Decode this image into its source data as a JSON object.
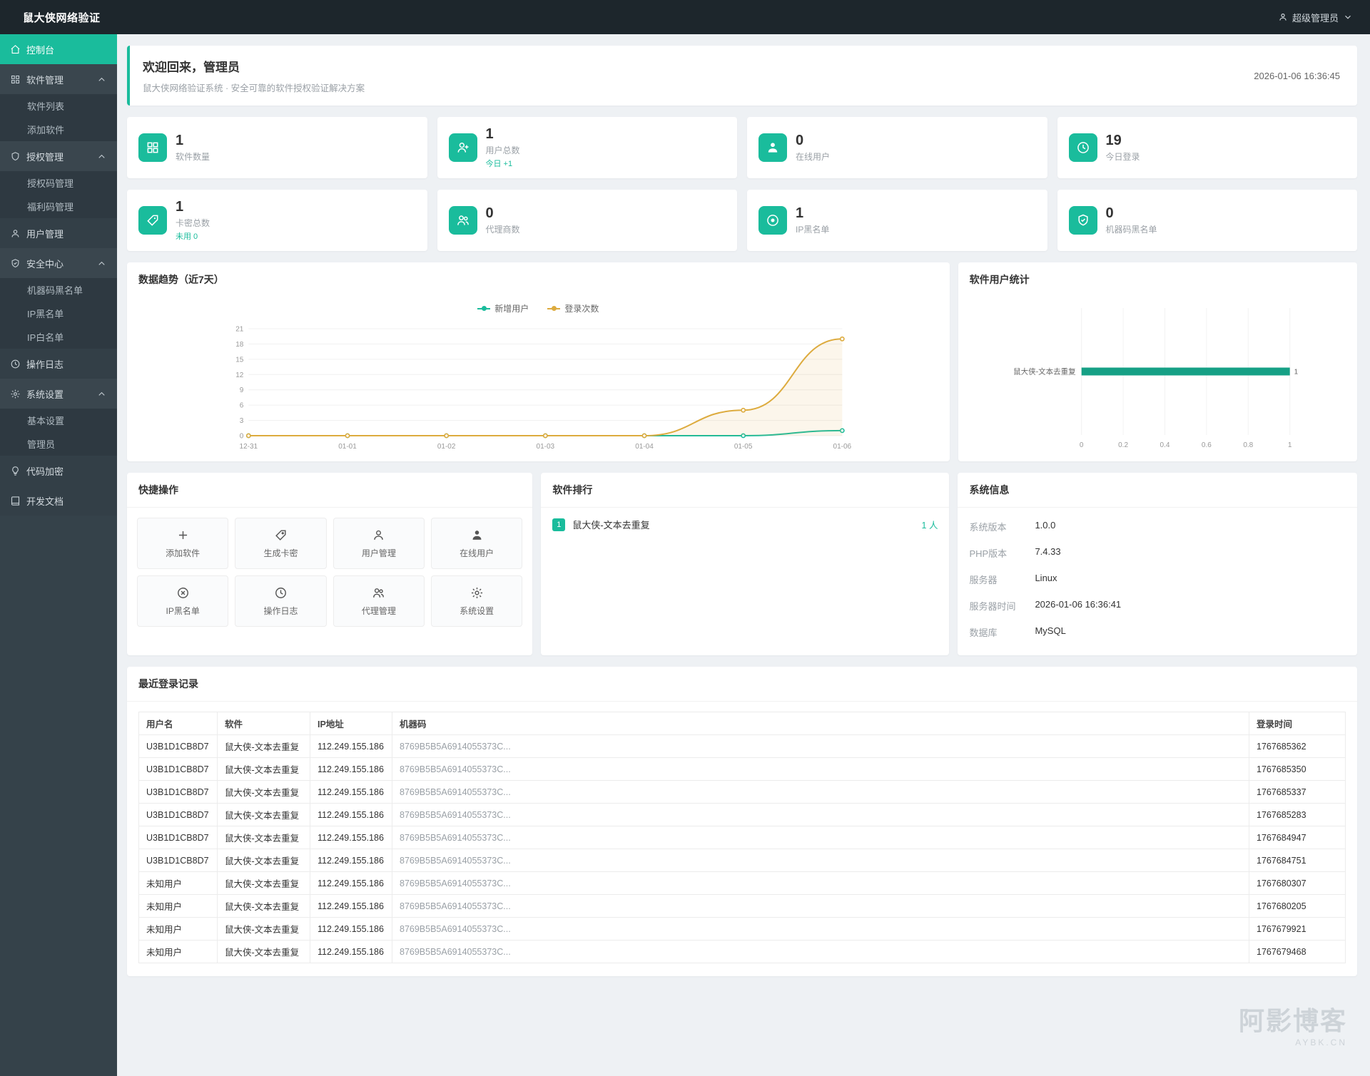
{
  "topbar": {
    "title": "鼠大侠网络验证",
    "user_label": "超级管理员"
  },
  "sidebar": {
    "items": [
      {
        "label": "控制台"
      },
      {
        "label": "软件管理"
      },
      {
        "label": "软件列表"
      },
      {
        "label": "添加软件"
      },
      {
        "label": "授权管理"
      },
      {
        "label": "授权码管理"
      },
      {
        "label": "福利码管理"
      },
      {
        "label": "用户管理"
      },
      {
        "label": "安全中心"
      },
      {
        "label": "机器码黑名单"
      },
      {
        "label": "IP黑名单"
      },
      {
        "label": "IP白名单"
      },
      {
        "label": "操作日志"
      },
      {
        "label": "系统设置"
      },
      {
        "label": "基本设置"
      },
      {
        "label": "管理员"
      },
      {
        "label": "代码加密"
      },
      {
        "label": "开发文档"
      }
    ]
  },
  "welcome": {
    "title": "欢迎回来，管理员",
    "subtitle": "鼠大侠网络验证系统 · 安全可靠的软件授权验证解决方案",
    "time": "2026-01-06 16:36:45"
  },
  "stats": [
    {
      "value": "1",
      "label": "软件数量",
      "extra": ""
    },
    {
      "value": "1",
      "label": "用户总数",
      "extra": "今日 +1"
    },
    {
      "value": "0",
      "label": "在线用户",
      "extra": ""
    },
    {
      "value": "19",
      "label": "今日登录",
      "extra": ""
    },
    {
      "value": "1",
      "label": "卡密总数",
      "extra": "未用 0"
    },
    {
      "value": "0",
      "label": "代理商数",
      "extra": ""
    },
    {
      "value": "1",
      "label": "IP黑名单",
      "extra": ""
    },
    {
      "value": "0",
      "label": "机器码黑名单",
      "extra": ""
    }
  ],
  "chart_data": [
    {
      "type": "line",
      "title": "数据趋势（近7天）",
      "x": [
        "12-31",
        "01-01",
        "01-02",
        "01-03",
        "01-04",
        "01-05",
        "01-06"
      ],
      "series": [
        {
          "name": "新增用户",
          "color": "#1abc9c",
          "values": [
            0,
            0,
            0,
            0,
            0,
            0,
            1
          ]
        },
        {
          "name": "登录次数",
          "color": "#ddab3e",
          "values": [
            0,
            0,
            0,
            0,
            0,
            5,
            19
          ]
        }
      ],
      "ylim": [
        0,
        21
      ],
      "yticks": [
        0,
        3,
        6,
        9,
        12,
        15,
        18,
        21
      ],
      "legend_position": "top",
      "grid": true
    },
    {
      "type": "bar",
      "title": "软件用户统计",
      "orientation": "horizontal",
      "categories": [
        "鼠大侠-文本去重复"
      ],
      "values": [
        1
      ],
      "color": "#16a085",
      "xlim": [
        0,
        1
      ],
      "xticks": [
        "0",
        "0.2",
        "0.4",
        "0.6",
        "0.8",
        "1"
      ]
    }
  ],
  "quick_actions": {
    "title": "快捷操作",
    "items": [
      {
        "label": "添加软件",
        "icon": "plus-icon"
      },
      {
        "label": "生成卡密",
        "icon": "tag-icon"
      },
      {
        "label": "用户管理",
        "icon": "user-icon"
      },
      {
        "label": "在线用户",
        "icon": "person-icon"
      },
      {
        "label": "IP黑名单",
        "icon": "ban-icon"
      },
      {
        "label": "操作日志",
        "icon": "clock-icon"
      },
      {
        "label": "代理管理",
        "icon": "users-icon"
      },
      {
        "label": "系统设置",
        "icon": "gear-icon"
      }
    ]
  },
  "software_ranking": {
    "title": "软件排行",
    "items": [
      {
        "rank": "1",
        "name": "鼠大侠-文本去重复",
        "count": "1 人"
      }
    ]
  },
  "system_info": {
    "title": "系统信息",
    "rows": [
      {
        "label": "系统版本",
        "value": "1.0.0"
      },
      {
        "label": "PHP版本",
        "value": "7.4.33"
      },
      {
        "label": "服务器",
        "value": "Linux"
      },
      {
        "label": "服务器时间",
        "value": "2026-01-06 16:36:41"
      },
      {
        "label": "数据库",
        "value": "MySQL"
      }
    ]
  },
  "login_records": {
    "title": "最近登录记录",
    "columns": [
      "用户名",
      "软件",
      "IP地址",
      "机器码",
      "登录时间"
    ],
    "rows": [
      {
        "username": "U3B1D1CB8D7",
        "software": "鼠大侠-文本去重复",
        "ip": "112.249.155.186",
        "machine": "8769B5B5A6914055373C...",
        "time": "1767685362"
      },
      {
        "username": "U3B1D1CB8D7",
        "software": "鼠大侠-文本去重复",
        "ip": "112.249.155.186",
        "machine": "8769B5B5A6914055373C...",
        "time": "1767685350"
      },
      {
        "username": "U3B1D1CB8D7",
        "software": "鼠大侠-文本去重复",
        "ip": "112.249.155.186",
        "machine": "8769B5B5A6914055373C...",
        "time": "1767685337"
      },
      {
        "username": "U3B1D1CB8D7",
        "software": "鼠大侠-文本去重复",
        "ip": "112.249.155.186",
        "machine": "8769B5B5A6914055373C...",
        "time": "1767685283"
      },
      {
        "username": "U3B1D1CB8D7",
        "software": "鼠大侠-文本去重复",
        "ip": "112.249.155.186",
        "machine": "8769B5B5A6914055373C...",
        "time": "1767684947"
      },
      {
        "username": "U3B1D1CB8D7",
        "software": "鼠大侠-文本去重复",
        "ip": "112.249.155.186",
        "machine": "8769B5B5A6914055373C...",
        "time": "1767684751"
      },
      {
        "username": "未知用户",
        "software": "鼠大侠-文本去重复",
        "ip": "112.249.155.186",
        "machine": "8769B5B5A6914055373C...",
        "time": "1767680307"
      },
      {
        "username": "未知用户",
        "software": "鼠大侠-文本去重复",
        "ip": "112.249.155.186",
        "machine": "8769B5B5A6914055373C...",
        "time": "1767680205"
      },
      {
        "username": "未知用户",
        "software": "鼠大侠-文本去重复",
        "ip": "112.249.155.186",
        "machine": "8769B5B5A6914055373C...",
        "time": "1767679921"
      },
      {
        "username": "未知用户",
        "software": "鼠大侠-文本去重复",
        "ip": "112.249.155.186",
        "machine": "8769B5B5A6914055373C...",
        "time": "1767679468"
      }
    ]
  },
  "watermark": {
    "line1": "阿影博客",
    "line2": "AYBK.CN"
  },
  "colors": {
    "accent": "#1abc9c",
    "accent_dark": "#16a085",
    "series_yellow": "#ddab3e",
    "topbar_bg": "#1d262c",
    "sidebar_bg": "#35424a"
  }
}
